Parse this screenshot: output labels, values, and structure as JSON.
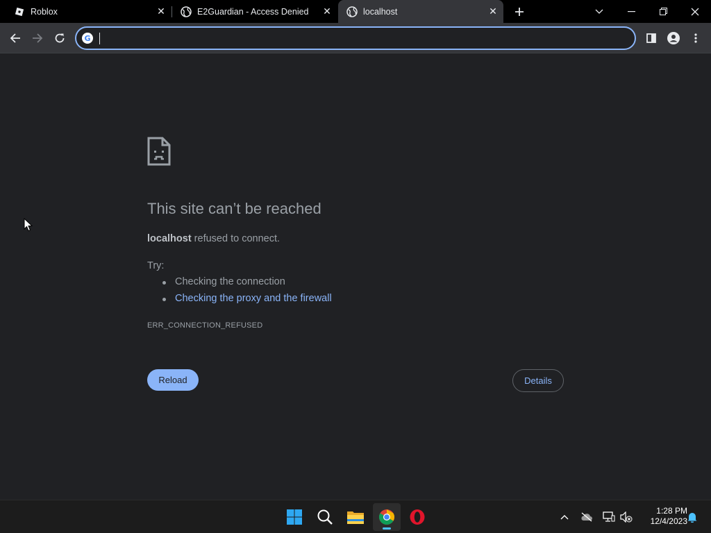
{
  "tabs": [
    {
      "title": "Roblox",
      "icon": "roblox-icon"
    },
    {
      "title": "E2Guardian - Access Denied",
      "icon": "globe-icon"
    },
    {
      "title": "localhost",
      "icon": "globe-icon",
      "active": true
    }
  ],
  "omnibox": {
    "value": "",
    "icon": "google-g-icon",
    "g_letter": "G"
  },
  "error": {
    "title": "This site can’t be reached",
    "host": "localhost",
    "message": " refused to connect.",
    "try_label": "Try:",
    "suggestions": [
      "Checking the connection",
      "Checking the proxy and the firewall"
    ],
    "code": "ERR_CONNECTION_REFUSED",
    "reload_label": "Reload",
    "details_label": "Details"
  },
  "taskbar": {
    "apps": [
      "windows-start-icon",
      "search-icon",
      "file-explorer-icon",
      "chrome-icon",
      "opera-icon"
    ],
    "time": "1:28 PM",
    "date": "12/4/2023"
  },
  "colors": {
    "accent": "#8ab4f8",
    "page_bg": "#202124",
    "toolbar_bg": "#35363a"
  }
}
